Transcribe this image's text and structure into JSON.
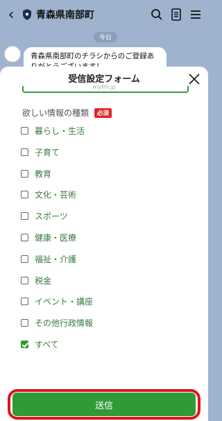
{
  "appbar": {
    "back": "‹",
    "title": "青森県南部町"
  },
  "chat": {
    "date": "今日",
    "message": "青森県南部町のチラシからのご登録ありがとうございます！"
  },
  "sheet": {
    "title": "受信設定フォーム",
    "subtitle": "myfm.jp"
  },
  "section": {
    "label": "欲しい情報の種類",
    "required": "必須"
  },
  "options": [
    {
      "label": "暮らし・生活",
      "checked": false
    },
    {
      "label": "子育て",
      "checked": false
    },
    {
      "label": "教育",
      "checked": false
    },
    {
      "label": "文化・芸術",
      "checked": false
    },
    {
      "label": "スポーツ",
      "checked": false
    },
    {
      "label": "健康・医療",
      "checked": false
    },
    {
      "label": "福祉・介護",
      "checked": false
    },
    {
      "label": "税金",
      "checked": false
    },
    {
      "label": "イベント・講座",
      "checked": false
    },
    {
      "label": "その他行政情報",
      "checked": false
    },
    {
      "label": "すべて",
      "checked": true
    }
  ],
  "submit": {
    "label": "送信"
  },
  "colors": {
    "accent": "#2f9a36",
    "required": "#e0252b",
    "highlight": "#e0131c"
  }
}
